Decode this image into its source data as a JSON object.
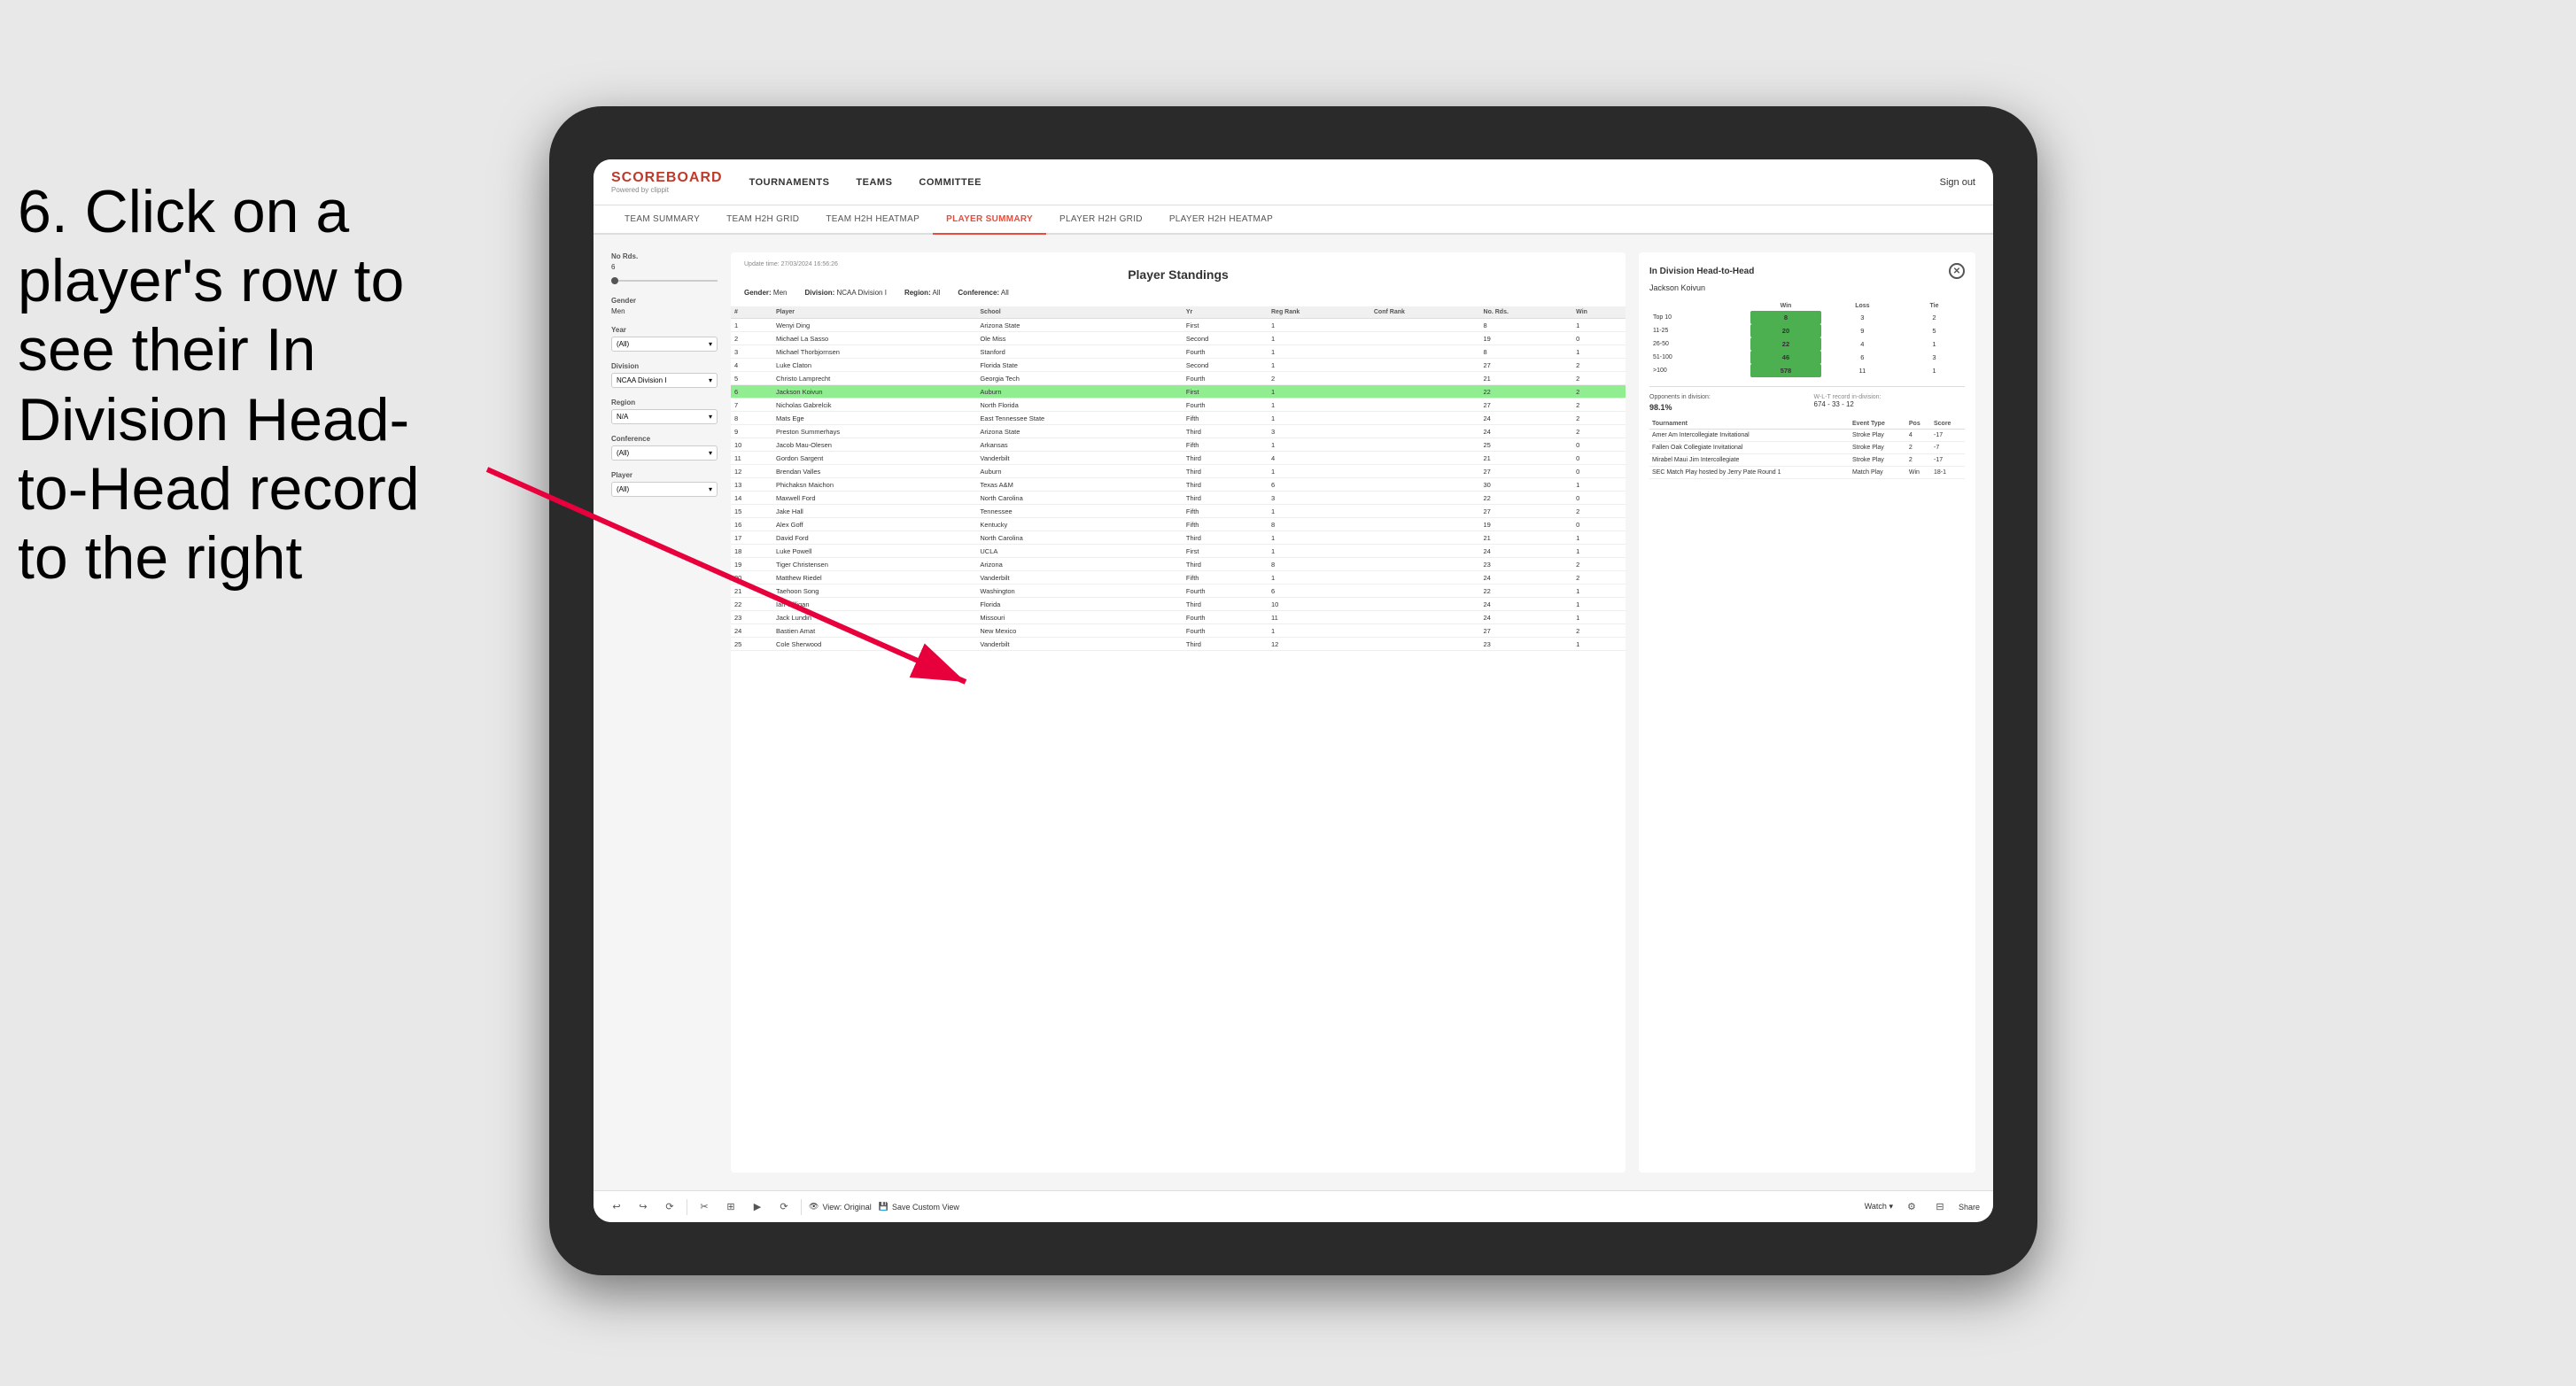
{
  "instruction": {
    "step": "6.",
    "text": "Click on a player's row to see their In Division Head-to-Head record to the right"
  },
  "app": {
    "logo": {
      "scoreboard": "SCOREBOARD",
      "powered": "Powered by clippit"
    },
    "nav": {
      "items": [
        "TOURNAMENTS",
        "TEAMS",
        "COMMITTEE"
      ],
      "sign_out": "Sign out"
    },
    "subnav": {
      "items": [
        "TEAM SUMMARY",
        "TEAM H2H GRID",
        "TEAM H2H HEATMAP",
        "PLAYER SUMMARY",
        "PLAYER H2H GRID",
        "PLAYER H2H HEATMAP"
      ],
      "active": "PLAYER SUMMARY"
    }
  },
  "filters": {
    "no_rds_label": "No Rds.",
    "no_rds_value": "6",
    "gender_label": "Gender",
    "gender_value": "Men",
    "year_label": "Year",
    "year_value": "(All)",
    "division_label": "Division",
    "division_value": "NCAA Division I",
    "region_label": "Region",
    "region_value": "N/A",
    "conference_label": "Conference",
    "conference_value": "(All)",
    "player_label": "Player",
    "player_value": "(All)"
  },
  "standings": {
    "update_time": "Update time:",
    "update_datetime": "27/03/2024 16:56:26",
    "title": "Player Standings",
    "gender_label": "Gender:",
    "gender_value": "Men",
    "division_label": "Division:",
    "division_value": "NCAA Division I",
    "region_label": "Region:",
    "region_value": "All",
    "conference_label": "Conference:",
    "conference_value": "All",
    "columns": [
      "#",
      "Player",
      "School",
      "Yr",
      "Reg Rank",
      "Conf Rank",
      "No. Rds.",
      "Win"
    ],
    "rows": [
      {
        "rank": "1",
        "player": "Wenyi Ding",
        "school": "Arizona State",
        "yr": "First",
        "reg_rank": "1",
        "conf_rank": "",
        "no_rds": "8",
        "win": "1"
      },
      {
        "rank": "2",
        "player": "Michael La Sasso",
        "school": "Ole Miss",
        "yr": "Second",
        "reg_rank": "1",
        "conf_rank": "",
        "no_rds": "19",
        "win": "0"
      },
      {
        "rank": "3",
        "player": "Michael Thorbjornsen",
        "school": "Stanford",
        "yr": "Fourth",
        "reg_rank": "1",
        "conf_rank": "",
        "no_rds": "8",
        "win": "1"
      },
      {
        "rank": "4",
        "player": "Luke Claton",
        "school": "Florida State",
        "yr": "Second",
        "reg_rank": "1",
        "conf_rank": "",
        "no_rds": "27",
        "win": "2"
      },
      {
        "rank": "5",
        "player": "Christo Lamprecht",
        "school": "Georgia Tech",
        "yr": "Fourth",
        "reg_rank": "2",
        "conf_rank": "",
        "no_rds": "21",
        "win": "2"
      },
      {
        "rank": "6",
        "player": "Jackson Koivun",
        "school": "Auburn",
        "yr": "First",
        "reg_rank": "1",
        "conf_rank": "",
        "no_rds": "22",
        "win": "2",
        "highlighted": true
      },
      {
        "rank": "7",
        "player": "Nicholas Gabrelcik",
        "school": "North Florida",
        "yr": "Fourth",
        "reg_rank": "1",
        "conf_rank": "",
        "no_rds": "27",
        "win": "2"
      },
      {
        "rank": "8",
        "player": "Mats Ege",
        "school": "East Tennessee State",
        "yr": "Fifth",
        "reg_rank": "1",
        "conf_rank": "",
        "no_rds": "24",
        "win": "2"
      },
      {
        "rank": "9",
        "player": "Preston Summerhays",
        "school": "Arizona State",
        "yr": "Third",
        "reg_rank": "3",
        "conf_rank": "",
        "no_rds": "24",
        "win": "2"
      },
      {
        "rank": "10",
        "player": "Jacob Mau-Olesen",
        "school": "Arkansas",
        "yr": "Fifth",
        "reg_rank": "1",
        "conf_rank": "",
        "no_rds": "25",
        "win": "0"
      },
      {
        "rank": "11",
        "player": "Gordon Sargent",
        "school": "Vanderbilt",
        "yr": "Third",
        "reg_rank": "4",
        "conf_rank": "",
        "no_rds": "21",
        "win": "0"
      },
      {
        "rank": "12",
        "player": "Brendan Valles",
        "school": "Auburn",
        "yr": "Third",
        "reg_rank": "1",
        "conf_rank": "",
        "no_rds": "27",
        "win": "0"
      },
      {
        "rank": "13",
        "player": "Phichaksn Maichon",
        "school": "Texas A&M",
        "yr": "Third",
        "reg_rank": "6",
        "conf_rank": "",
        "no_rds": "30",
        "win": "1"
      },
      {
        "rank": "14",
        "player": "Maxwell Ford",
        "school": "North Carolina",
        "yr": "Third",
        "reg_rank": "3",
        "conf_rank": "",
        "no_rds": "22",
        "win": "0"
      },
      {
        "rank": "15",
        "player": "Jake Hall",
        "school": "Tennessee",
        "yr": "Fifth",
        "reg_rank": "1",
        "conf_rank": "",
        "no_rds": "27",
        "win": "2"
      },
      {
        "rank": "16",
        "player": "Alex Goff",
        "school": "Kentucky",
        "yr": "Fifth",
        "reg_rank": "8",
        "conf_rank": "",
        "no_rds": "19",
        "win": "0"
      },
      {
        "rank": "17",
        "player": "David Ford",
        "school": "North Carolina",
        "yr": "Third",
        "reg_rank": "1",
        "conf_rank": "",
        "no_rds": "21",
        "win": "1"
      },
      {
        "rank": "18",
        "player": "Luke Powell",
        "school": "UCLA",
        "yr": "First",
        "reg_rank": "1",
        "conf_rank": "",
        "no_rds": "24",
        "win": "1"
      },
      {
        "rank": "19",
        "player": "Tiger Christensen",
        "school": "Arizona",
        "yr": "Third",
        "reg_rank": "8",
        "conf_rank": "",
        "no_rds": "23",
        "win": "2"
      },
      {
        "rank": "20",
        "player": "Matthew Riedel",
        "school": "Vanderbilt",
        "yr": "Fifth",
        "reg_rank": "1",
        "conf_rank": "",
        "no_rds": "24",
        "win": "2"
      },
      {
        "rank": "21",
        "player": "Taehoon Song",
        "school": "Washington",
        "yr": "Fourth",
        "reg_rank": "6",
        "conf_rank": "",
        "no_rds": "22",
        "win": "1"
      },
      {
        "rank": "22",
        "player": "Ian Gilligan",
        "school": "Florida",
        "yr": "Third",
        "reg_rank": "10",
        "conf_rank": "",
        "no_rds": "24",
        "win": "1"
      },
      {
        "rank": "23",
        "player": "Jack Lundin",
        "school": "Missouri",
        "yr": "Fourth",
        "reg_rank": "11",
        "conf_rank": "",
        "no_rds": "24",
        "win": "1"
      },
      {
        "rank": "24",
        "player": "Bastien Amat",
        "school": "New Mexico",
        "yr": "Fourth",
        "reg_rank": "1",
        "conf_rank": "",
        "no_rds": "27",
        "win": "2"
      },
      {
        "rank": "25",
        "player": "Cole Sherwood",
        "school": "Vanderbilt",
        "yr": "Third",
        "reg_rank": "12",
        "conf_rank": "",
        "no_rds": "23",
        "win": "1"
      }
    ]
  },
  "h2h": {
    "title": "In Division Head-to-Head",
    "player_name": "Jackson Koivun",
    "table_headers": [
      "",
      "Win",
      "Loss",
      "Tie"
    ],
    "rows": [
      {
        "range": "Top 10",
        "win": "8",
        "loss": "3",
        "tie": "2"
      },
      {
        "range": "11-25",
        "win": "20",
        "loss": "9",
        "tie": "5"
      },
      {
        "range": "26-50",
        "win": "22",
        "loss": "4",
        "tie": "1"
      },
      {
        "range": "51-100",
        "win": "46",
        "loss": "6",
        "tie": "3"
      },
      {
        "range": ">100",
        "win": "578",
        "loss": "11",
        "tie": "1"
      }
    ],
    "opponents_label": "Opponents in division:",
    "wlt_label": "W-L-T record in-division:",
    "percentage": "98.1%",
    "wlt_record": "674 - 33 - 12",
    "tournament_headers": [
      "Tournament",
      "Event Type",
      "Pos",
      "Score"
    ],
    "tournaments": [
      {
        "name": "Amer Am Intercollegiate Invitational",
        "type": "Stroke Play",
        "pos": "4",
        "score": "-17"
      },
      {
        "name": "Fallen Oak Collegiate Invitational",
        "type": "Stroke Play",
        "pos": "2",
        "score": "-7"
      },
      {
        "name": "Mirabel Maui Jim Intercollegiate",
        "type": "Stroke Play",
        "pos": "2",
        "score": "-17"
      },
      {
        "name": "SEC Match Play hosted by Jerry Pate Round 1",
        "type": "Match Play",
        "pos": "Win",
        "score": "18-1"
      }
    ]
  },
  "toolbar": {
    "buttons": [
      "↩",
      "↪",
      "⟳",
      "✂",
      "⊞",
      "▶",
      "⟳"
    ],
    "view_label": "View: Original",
    "save_label": "Save Custom View",
    "watch_label": "Watch ▾",
    "share_label": "Share"
  }
}
